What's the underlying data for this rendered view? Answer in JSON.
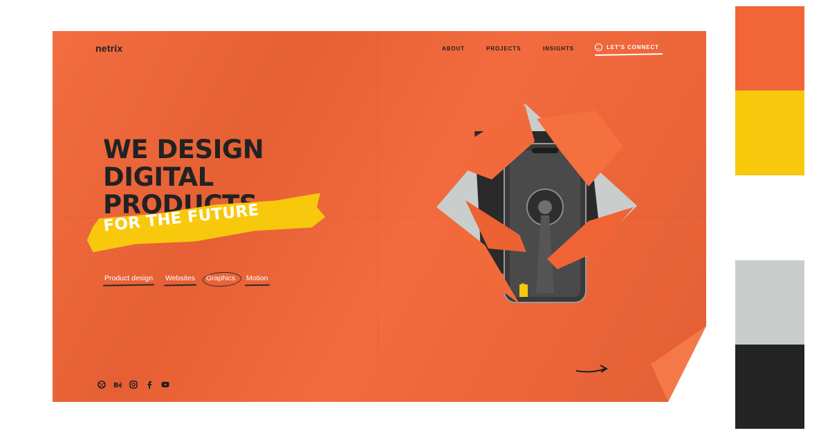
{
  "site": {
    "logo": "netrix",
    "nav": {
      "about": "ABOUT",
      "projects": "PROJECTS",
      "insights": "INSIGHTS",
      "connect": "LET'S CONNECT"
    },
    "hero": {
      "line1": "WE DESIGN",
      "line2": "DIGITAL",
      "line3": "PRODUCTS",
      "highlight": "FOR THE FUTURE"
    },
    "tags": [
      "Product design",
      "Websites",
      "Graphics",
      "Motion"
    ],
    "socials": [
      "dribbble-icon",
      "behance-icon",
      "instagram-icon",
      "facebook-icon",
      "youtube-icon"
    ]
  },
  "palette": [
    "#f26537",
    "#f8c80d",
    "#c9cdcb",
    "#242424"
  ]
}
